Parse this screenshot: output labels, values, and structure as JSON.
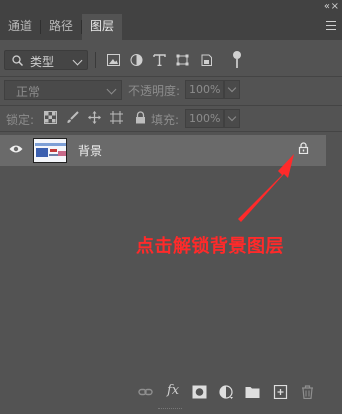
{
  "window": {
    "collapse_label": "«",
    "close_label": "×"
  },
  "tabs": [
    {
      "label": "通道",
      "active": false
    },
    {
      "label": "路径",
      "active": false
    },
    {
      "label": "图层",
      "active": true
    }
  ],
  "filter": {
    "kind_label": "类型",
    "icons": [
      "image-filter-icon",
      "adjustment-filter-icon",
      "type-filter-icon",
      "shape-filter-icon",
      "smart-object-filter-icon",
      "filter-toggle-icon"
    ]
  },
  "blend": {
    "mode": "正常",
    "opacity_label": "不透明度:",
    "opacity_value": "100%"
  },
  "locks": {
    "label": "锁定:",
    "icons": [
      "lock-transparent-pixels-icon",
      "lock-image-pixels-icon",
      "lock-position-icon",
      "lock-artboard-icon",
      "lock-all-icon"
    ],
    "fill_label": "填充:",
    "fill_value": "100%"
  },
  "layers": [
    {
      "name": "背景",
      "visible": true,
      "locked": true
    }
  ],
  "annotation": {
    "text": "点击解锁背景图层",
    "color": "#ff2a2a"
  },
  "bottom_toolbar": {
    "fx_label": "fx",
    "icons": [
      "link-layers-icon",
      "layer-style-icon",
      "add-mask-icon",
      "adjustment-layer-icon",
      "new-group-icon",
      "new-layer-icon",
      "delete-layer-icon"
    ]
  },
  "colors": {
    "panel_bg": "#535353",
    "tabbar_bg": "#424242",
    "selected_row": "#6a6a6a"
  }
}
